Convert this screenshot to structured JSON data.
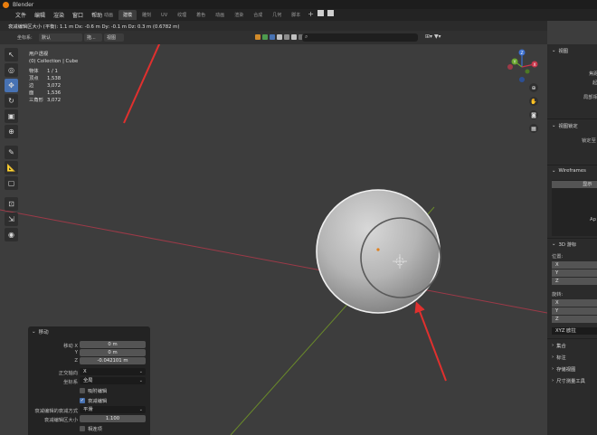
{
  "titlebar": {
    "title": "Blender"
  },
  "menu": [
    "文件",
    "编辑",
    "渲染",
    "窗口",
    "帮助"
  ],
  "workspace_tabs": [
    "动画",
    "建模",
    "雕刻",
    "UV",
    "纹理",
    "着色",
    "动画",
    "渲染",
    "合成",
    "几何",
    "脚本"
  ],
  "active_workspace_index": 1,
  "status_header": "衰减编辑区大小 (平衡): 1.1 m   Dx: -0.6 m   Dy: -0.1 m   Dz: 0.3 m (0.6782 m)",
  "toolheader": {
    "orientation_label": "坐标系:",
    "orientation_value": "默认",
    "pivot_value": "拖...",
    "view_value": "视图"
  },
  "stats": {
    "mode": "用户透视",
    "collection": "(0) Collection | Cube",
    "rows": [
      {
        "k": "物体",
        "v": "1 / 1"
      },
      {
        "k": "顶点",
        "v": "1,538"
      },
      {
        "k": "边",
        "v": "3,072"
      },
      {
        "k": "面",
        "v": "1,536"
      },
      {
        "k": "三角形",
        "v": "3,072"
      }
    ]
  },
  "gizmo": {
    "z": "Z",
    "y": "Y",
    "x": "X"
  },
  "operator_panel": {
    "title": "移动",
    "move_x_label": "移动 X",
    "move_x": "0 m",
    "move_y_label": "Y",
    "move_y": "0 m",
    "move_z_label": "Z",
    "move_z": "-0.042101 m",
    "orient_axis_label": "正交轴向",
    "orient_axis": "X",
    "coord_label": "坐标系",
    "coord": "全局",
    "snap_label": "吸附编辑",
    "prop_edit_label": "衰减编辑",
    "falloff_label": "衰减编辑的衰减方式",
    "falloff": "平滑",
    "size_label": "衰减编辑区大小",
    "size": "1.100",
    "connected_label": "相连项"
  },
  "sidebar": {
    "view_header": "视图",
    "focal": "焦距",
    "clip_start": "起",
    "local_cam": "局部相",
    "view_lock_header": "视图锁定",
    "lock_to": "锁定至",
    "wireframes_header": "Wireframes",
    "wf_btn": "显示",
    "wf_apply": "Ap",
    "cursor_header": "3D 游标",
    "location_label": "位置:",
    "x": "X",
    "y": "Y",
    "z": "Z",
    "rotation_label": "旋转:",
    "rot_mode": "XYZ 欧拉",
    "items": [
      "集合",
      "标注",
      "存储视图",
      "尺寸测量工具"
    ]
  },
  "colors": {
    "accent": "#4772b3",
    "axis_x": "#9c3a48",
    "axis_y": "#6a8a2a",
    "arrow": "#e0302e"
  }
}
